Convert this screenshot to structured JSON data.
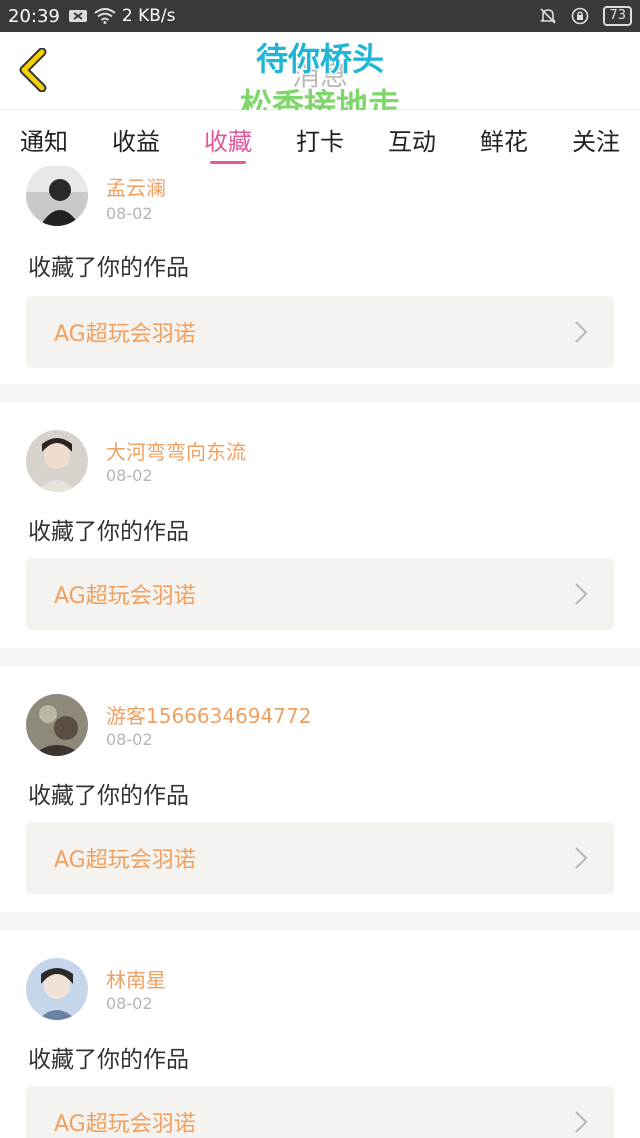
{
  "status_bar": {
    "time": "20:39",
    "speed": "2 KB/s",
    "battery": "73"
  },
  "header": {
    "title": "消息",
    "overlay_line1": "待你桥头",
    "overlay_line2": "松香接地走"
  },
  "tabs": [
    {
      "label": "通知"
    },
    {
      "label": "收益"
    },
    {
      "label": "收藏",
      "active": true
    },
    {
      "label": "打卡"
    },
    {
      "label": "互动"
    },
    {
      "label": "鲜花"
    },
    {
      "label": "关注"
    }
  ],
  "feed": [
    {
      "name": "孟云澜",
      "date": "08-02",
      "action": "收藏了你的作品",
      "work": "AG超玩会羽诺"
    },
    {
      "name": "大河弯弯向东流",
      "date": "08-02",
      "action": "收藏了你的作品",
      "work": "AG超玩会羽诺"
    },
    {
      "name": "游客1566634694772",
      "date": "08-02",
      "action": "收藏了你的作品",
      "work": "AG超玩会羽诺"
    },
    {
      "name": "林南星",
      "date": "08-02",
      "action": "收藏了你的作品",
      "work": "AG超玩会羽诺"
    }
  ],
  "colors": {
    "accent": "#e0589a",
    "name": "#f0a060",
    "back": "#f5d000"
  }
}
